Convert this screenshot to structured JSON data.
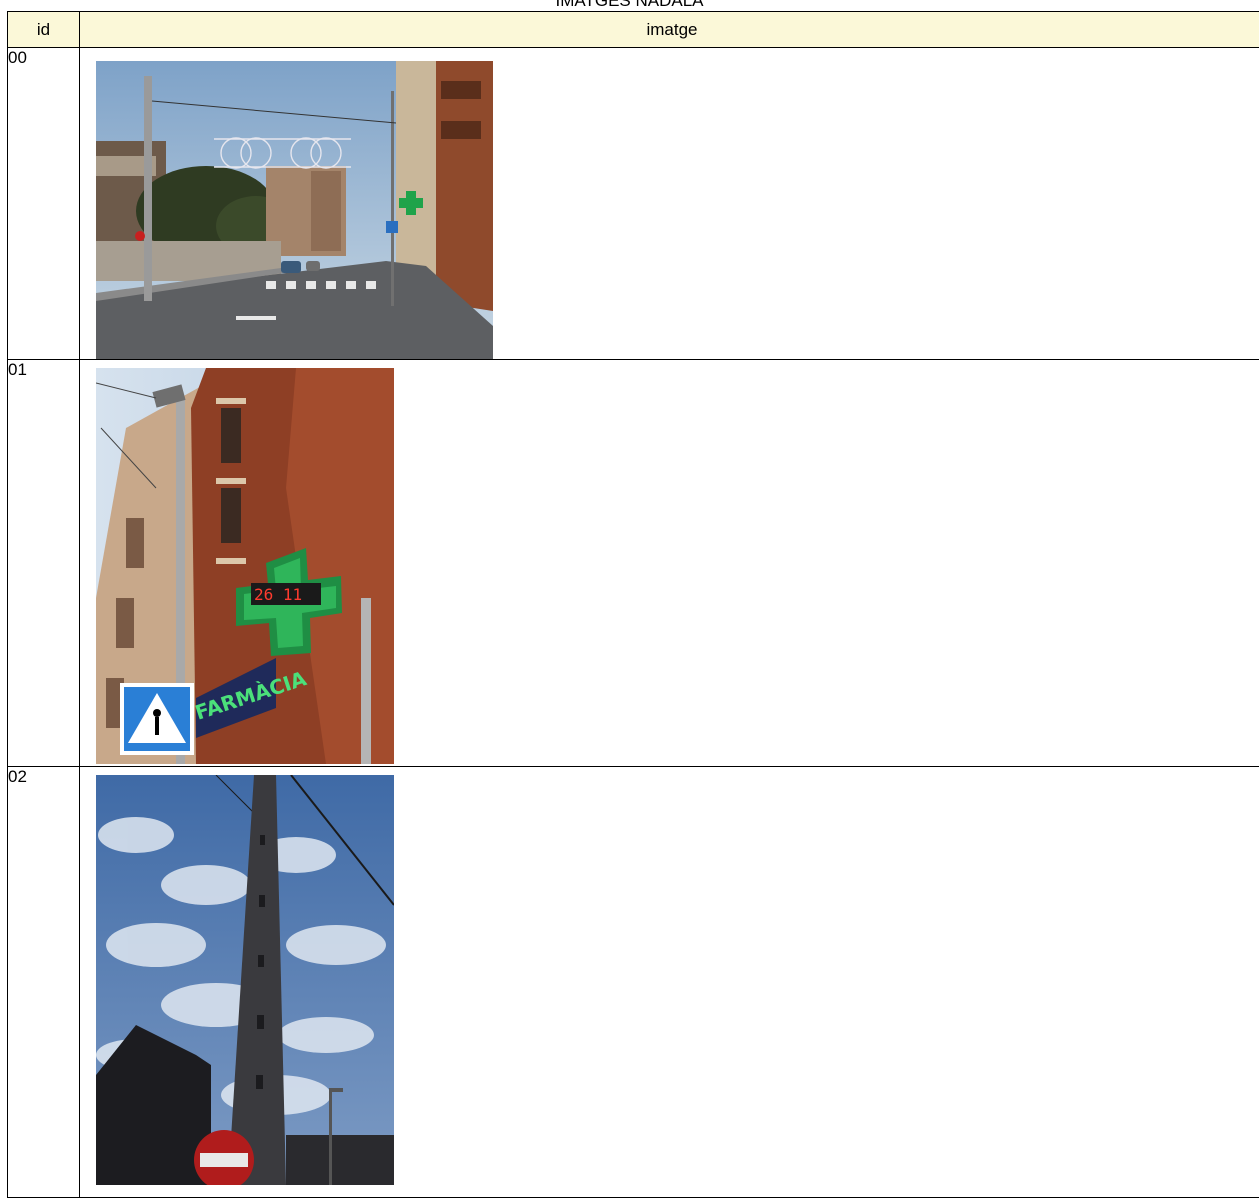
{
  "title": "IMATGES NADALA",
  "headers": {
    "id": "id",
    "image": "imatge"
  },
  "rows": [
    {
      "id": "00",
      "image": "street-corner-pharmacy-photo"
    },
    {
      "id": "01",
      "image": "pharmacy-cross-sign-photo",
      "sign_text": "FARMÀCIA",
      "display_text": "26 11"
    },
    {
      "id": "02",
      "image": "utility-pole-cloudy-sky-photo"
    }
  ],
  "colors": {
    "header_bg": "#fbf8d8",
    "border": "#000000"
  }
}
